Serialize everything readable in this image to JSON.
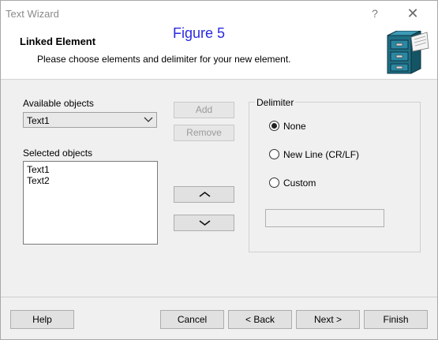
{
  "window": {
    "title": "Text Wizard",
    "help_glyph": "?",
    "close_glyph": "✕"
  },
  "header": {
    "title": "Linked Element",
    "figure_label": "Figure 5",
    "description": "Please choose elements and delimiter for your new element.",
    "icon": "file-cabinet-icon"
  },
  "available": {
    "label": "Available objects",
    "selected_value": "Text1"
  },
  "selected": {
    "label": "Selected objects",
    "items": [
      "Text1",
      "Text2"
    ]
  },
  "middle_buttons": {
    "add": "Add",
    "remove": "Remove",
    "up_glyph": "︿",
    "down_glyph": "﹀"
  },
  "delimiter": {
    "label": "Delimiter",
    "options": [
      {
        "label": "None",
        "checked": true
      },
      {
        "label": "New Line (CR/LF)",
        "checked": false
      },
      {
        "label": "Custom",
        "checked": false
      }
    ],
    "custom_value": ""
  },
  "footer": {
    "help": "Help",
    "cancel": "Cancel",
    "back": "< Back",
    "next": "Next >",
    "finish": "Finish"
  },
  "colors": {
    "figure_label": "#2a2ae0",
    "dialog_bg": "#f0f0f0",
    "header_bg": "#ffffff"
  }
}
